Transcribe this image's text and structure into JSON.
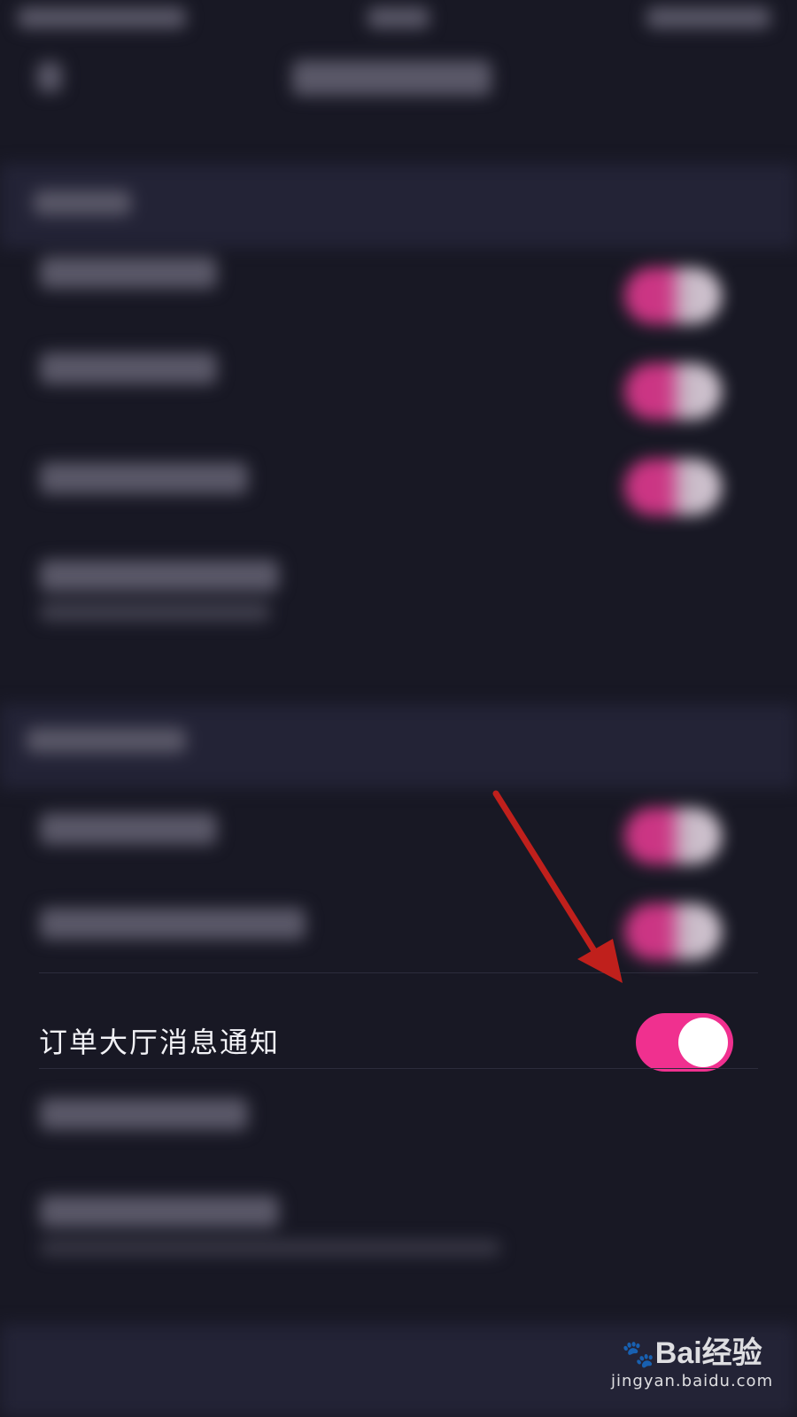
{
  "settings": {
    "order_hall_row": {
      "label": "订单大厅消息通知",
      "toggle_state": "on"
    }
  },
  "colors": {
    "background": "#181824",
    "accent": "#f0308f",
    "text": "#f2f2f6"
  },
  "watermark": {
    "logo": "Bai经验",
    "url": "jingyan.baidu.com"
  },
  "icons": {
    "annotation": "red-arrow-icon",
    "watermark_logo": "baidu-paw-icon"
  }
}
